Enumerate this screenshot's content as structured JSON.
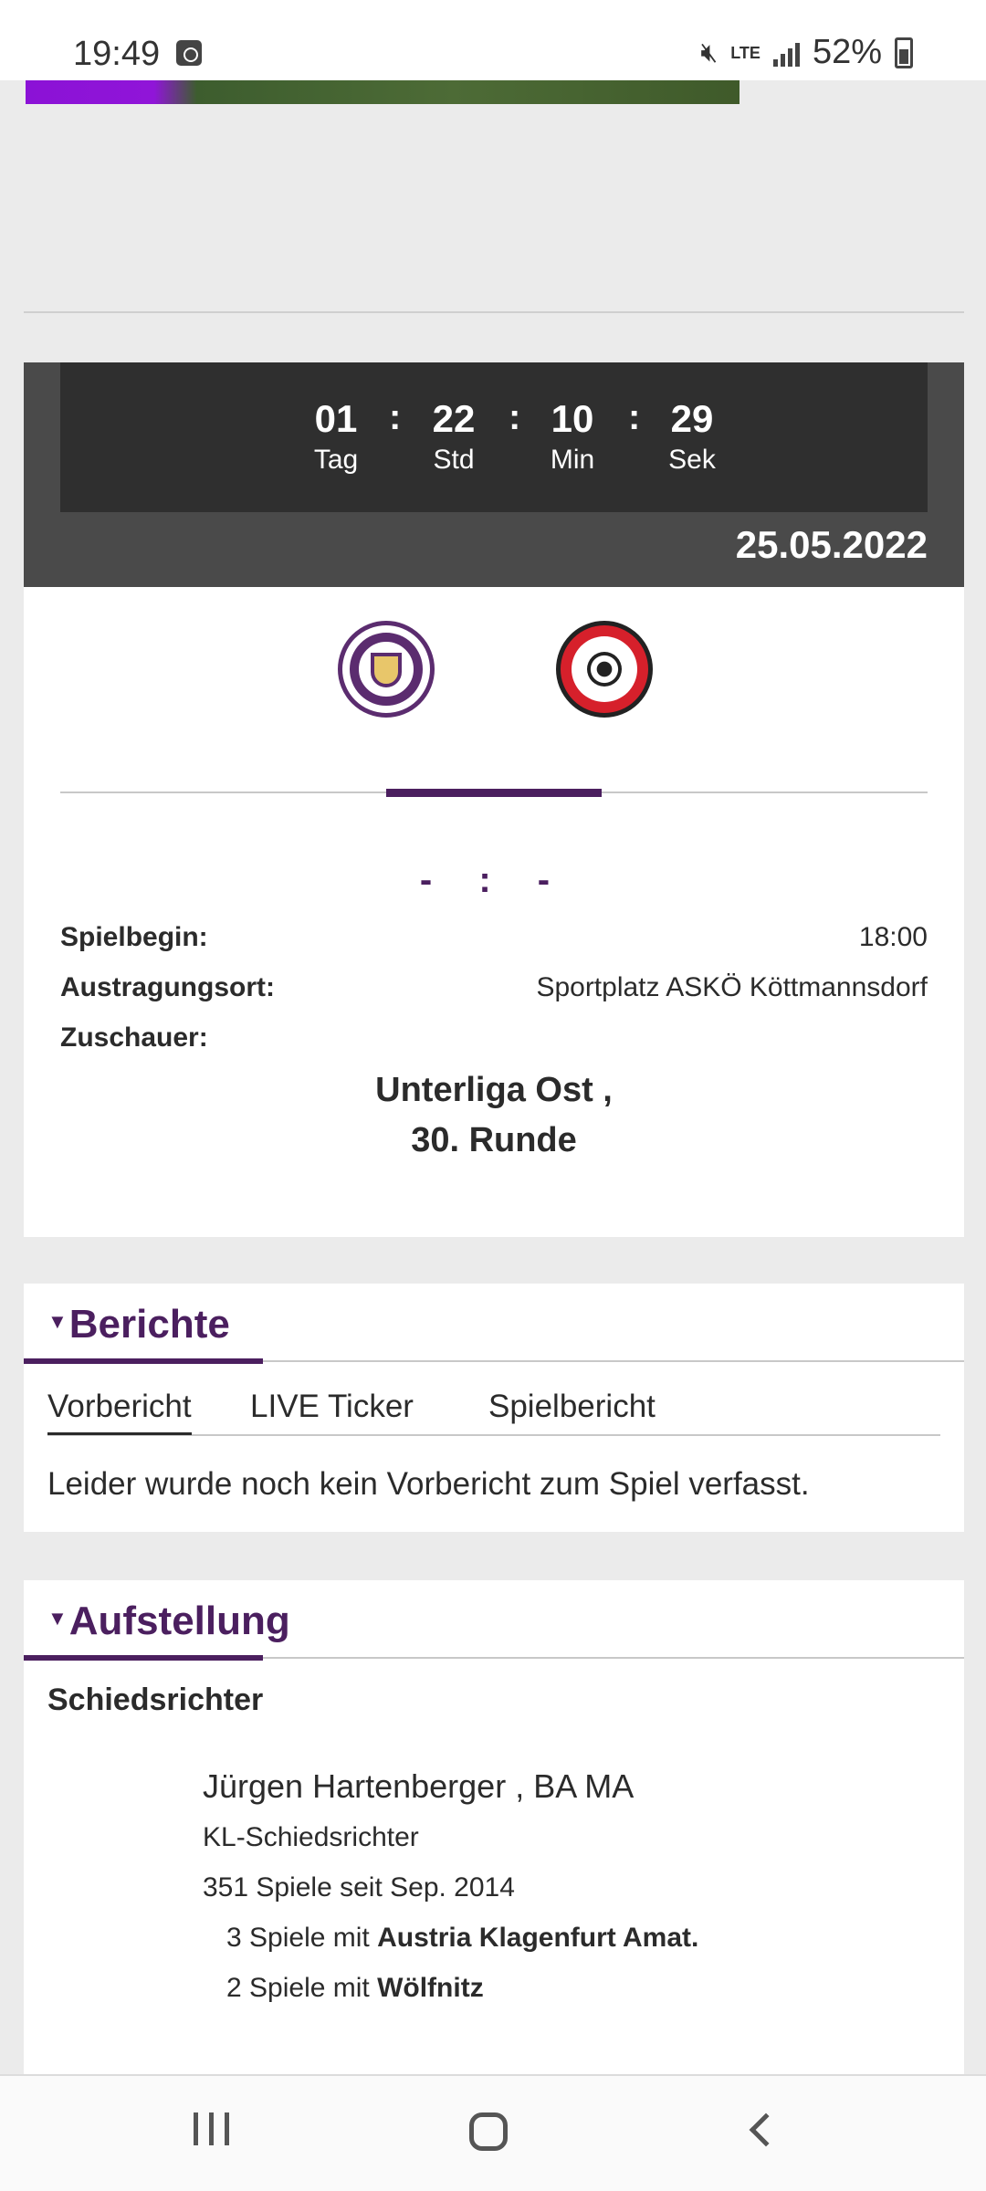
{
  "status_bar": {
    "time": "19:49",
    "lte": "LTE",
    "battery": "52%"
  },
  "countdown": {
    "days": "01",
    "days_label": "Tag",
    "hours": "22",
    "hours_label": "Std",
    "minutes": "10",
    "minutes_label": "Min",
    "seconds": "29",
    "seconds_label": "Sek",
    "separator": ":",
    "date": "25.05.2022"
  },
  "match": {
    "home_team": "Austria Klagenfurt Amat.",
    "away_team": "Wölfnitz",
    "score": "- : -",
    "kickoff_label": "Spielbegin:",
    "kickoff_value": "18:00",
    "venue_label": "Austragungsort:",
    "venue_value": "Sportplatz ASKÖ Köttmannsdorf",
    "spectators_label": "Zuschauer:",
    "spectators_value": "",
    "league_line1": "Unterliga Ost ,",
    "league_line2": "30. Runde"
  },
  "berichte": {
    "title": "Berichte",
    "tabs": [
      "Vorbericht",
      "LIVE Ticker",
      "Spielbericht"
    ],
    "active_tab": "Vorbericht",
    "empty_text": "Leider wurde noch kein Vorbericht zum Spiel verfasst."
  },
  "aufstellung": {
    "title": "Aufstellung",
    "referee_heading": "Schiedsrichter",
    "referee_name": "Jürgen Hartenberger , BA MA",
    "referee_role": "KL-Schiedsrichter",
    "referee_games": "351 Spiele seit Sep. 2014",
    "with_home_prefix": "3 Spiele mit ",
    "with_home_team": "Austria Klagenfurt Amat.",
    "with_away_prefix": "2 Spiele mit ",
    "with_away_team": "Wölfnitz"
  },
  "icons": {
    "alarm": "alarm-icon",
    "mute": "mute-icon",
    "signal": "signal-icon",
    "battery": "battery-icon",
    "recents": "recents-icon",
    "home": "home-icon",
    "back": "back-icon"
  },
  "colors": {
    "accent": "#4b1f5f",
    "countdown_bg": "#2f2f2f",
    "countdown_band": "#4a4a4a",
    "page_bg": "#ebebeb"
  }
}
